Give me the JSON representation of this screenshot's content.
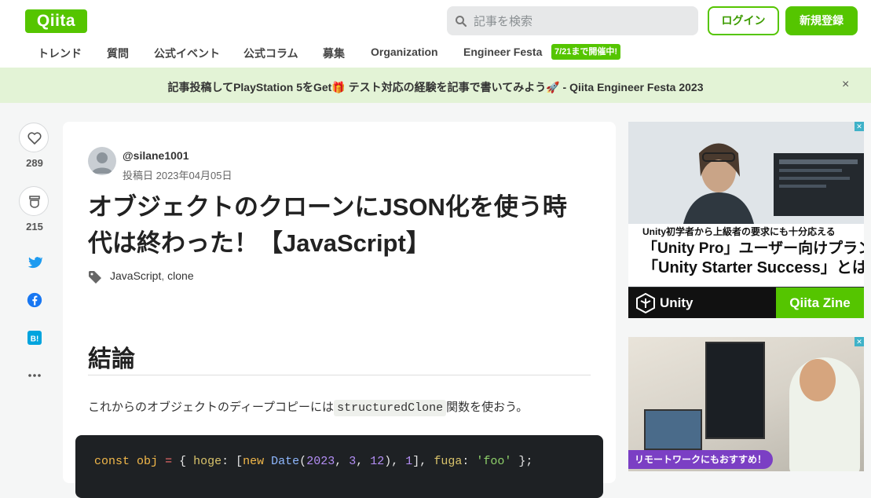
{
  "header": {
    "logo": "Qiita",
    "search_placeholder": "記事を検索",
    "login_label": "ログイン",
    "signup_label": "新規登録"
  },
  "nav": {
    "items": [
      "トレンド",
      "質問",
      "公式イベント",
      "公式コラム",
      "募集",
      "Organization",
      "Engineer Festa"
    ],
    "badge": "7/21まで開催中!"
  },
  "banner": {
    "text": "記事投稿してPlayStation 5をGet🎁 テスト対応の経験を記事で書いてみよう🚀 - Qiita Engineer Festa 2023",
    "close": "×"
  },
  "sidebar": {
    "like_count": "289",
    "stock_count": "215"
  },
  "article": {
    "username": "@silane1001",
    "posted": "投稿日 2023年04月05日",
    "title": "オブジェクトのクローンにJSON化を使う時代は終わった！【JavaScript】",
    "tags": [
      "JavaScript",
      "clone"
    ],
    "heading": "結論",
    "paragraph_before": "これからのオブジェクトのディープコピーには",
    "paragraph_code": "structuredClone",
    "paragraph_after": "関数を使おう。",
    "code": "const obj = { hoge: [new Date(2023, 3, 12), 1], fuga: 'foo' };"
  },
  "ads": {
    "ad1_line1": "Unity初学者から上級者の要求にも十分応える",
    "ad1_line2": "「Unity Pro」ユーザー向けプラン",
    "ad1_line3": "「Unity Starter Success」とは",
    "ad1_brand": "Unity",
    "ad1_zine": "Qiita Zine",
    "ad2_caption": "リモートワークにもおすすめ！"
  },
  "colors": {
    "brand": "#55c500",
    "banner_bg": "#e3f3d6",
    "code_bg": "#1e2124"
  }
}
